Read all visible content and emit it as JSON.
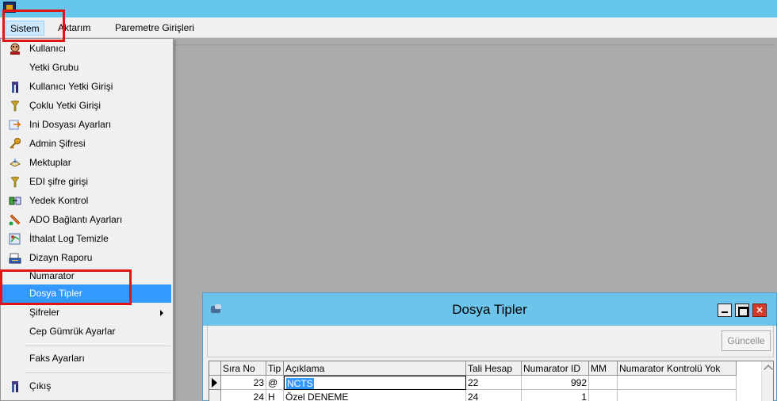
{
  "menubar": {
    "items": [
      "Sistem",
      "Aktarım",
      "Paremetre Girişleri"
    ]
  },
  "dropdown": {
    "items": [
      {
        "label": "Kullanıcı",
        "icon": "user-icon"
      },
      {
        "label": "Yetki Grubu",
        "icon": ""
      },
      {
        "label": "Kullanıcı Yetki Girişi",
        "icon": "user-permission-icon"
      },
      {
        "label": "Çoklu Yetki Girişi",
        "icon": "multi-permission-icon"
      },
      {
        "label": "Ini Dosyası  Ayarları",
        "icon": "ini-file-icon"
      },
      {
        "label": "Admin Şifresi",
        "icon": "key-icon"
      },
      {
        "label": "Mektuplar",
        "icon": "letter-icon"
      },
      {
        "label": "EDI şifre girişi",
        "icon": "edi-password-icon"
      },
      {
        "label": "Yedek Kontrol",
        "icon": "backup-icon"
      },
      {
        "label": "ADO Bağlantı Ayarları",
        "icon": "connection-icon"
      },
      {
        "label": "İthalat Log Temizle",
        "icon": "log-clean-icon"
      },
      {
        "label": "Dizayn Raporu",
        "icon": "report-design-icon"
      },
      {
        "label": "Numarator",
        "icon": ""
      },
      {
        "label": "Dosya Tipler",
        "icon": ""
      },
      {
        "label": "Şifreler",
        "icon": "",
        "submenu": true
      },
      {
        "label": "Cep Gümrük Ayarlar",
        "icon": ""
      },
      {
        "label": "Faks Ayarları",
        "icon": ""
      },
      {
        "label": "Çıkış",
        "icon": "exit-icon"
      }
    ],
    "selected": "Dosya Tipler"
  },
  "child_window": {
    "title": "Dosya Tipler",
    "update_button": "Güncelle",
    "columns": [
      "Sıra No",
      "Tip",
      "Açıklama",
      "Tali Hesap",
      "Numarator ID",
      "MM",
      "Numarator Kontrolü Yok"
    ],
    "rows": [
      [
        "23",
        "@",
        "NCTS",
        "22",
        "992",
        "",
        ""
      ],
      [
        "24",
        "H",
        "Özel DENEME",
        "24",
        "1",
        "",
        ""
      ]
    ]
  }
}
